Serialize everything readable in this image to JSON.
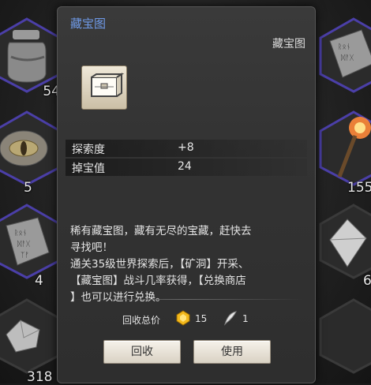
{
  "tooltip": {
    "title": "藏宝图",
    "type_label": "藏宝图",
    "stats": [
      {
        "key": "探索度",
        "value": "+8"
      },
      {
        "key": "掉宝值",
        "value": "24"
      }
    ],
    "description_lines": [
      "稀有藏宝图，藏有无尽的宝藏，赶快去",
      "寻找吧！",
      "通关35级世界探索后，【矿洞】开采、",
      "【藏宝图】战斗几率获得，【兑换商店",
      "】也可以进行兑换。"
    ],
    "recycle": {
      "label": "回收总价",
      "gold_amount": "15",
      "feather_amount": "1"
    },
    "buttons": {
      "recycle": "回收",
      "use": "使用"
    }
  },
  "inventory": [
    {
      "item": "jar-icon",
      "count": "54"
    },
    {
      "item": "eye-stone-icon",
      "count": "5"
    },
    {
      "item": "rune-tablet-icon",
      "count": "4"
    },
    {
      "item": "crystal-shard-icon",
      "count": "318"
    },
    {
      "item": "rune-tablet-icon",
      "count": ""
    },
    {
      "item": "fire-staff-icon",
      "count": "155"
    },
    {
      "item": "diamond-icon",
      "count": "6"
    }
  ],
  "colors": {
    "title": "#6f9ae8",
    "rarity_border": "#4b3fa8"
  }
}
